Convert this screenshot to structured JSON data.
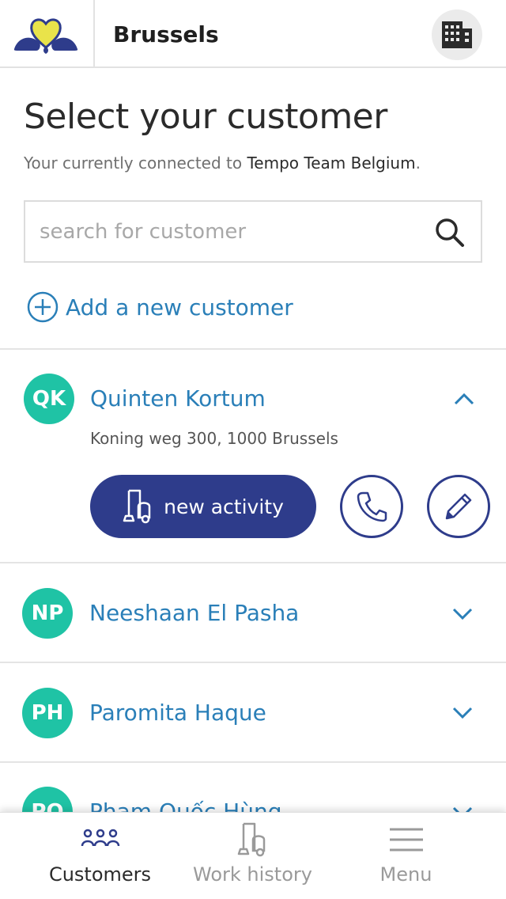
{
  "header": {
    "city": "Brussels",
    "brand_colors": {
      "heart": "#e9e34a",
      "leaves": "#2e3c8b"
    }
  },
  "intro": {
    "title": "Select your customer",
    "subtitle_prefix": "Your currently connected to ",
    "organization": "Tempo Team Belgium",
    "subtitle_suffix": "."
  },
  "search": {
    "placeholder": "search for customer",
    "value": ""
  },
  "add_customer": {
    "label": "Add a new customer"
  },
  "customers": [
    {
      "initials": "QK",
      "name": "Quinten Kortum",
      "address": "Koning weg 300, 1000 Brussels",
      "expanded": true,
      "new_activity_label": "new activity"
    },
    {
      "initials": "NP",
      "name": "Neeshaan El Pasha",
      "expanded": false
    },
    {
      "initials": "PH",
      "name": "Paromita Haque",
      "expanded": false
    },
    {
      "initials": "PQ",
      "name": "Pham Quốc Hùng",
      "expanded": false
    }
  ],
  "bottom_nav": [
    {
      "label": "Customers",
      "icon": "people-icon",
      "active": true
    },
    {
      "label": "Work history",
      "icon": "vacuum-icon",
      "active": false
    },
    {
      "label": "Menu",
      "icon": "hamburger-icon",
      "active": false
    }
  ],
  "colors": {
    "accent_blue": "#2a7fb8",
    "primary_navy": "#2e3c8b",
    "avatar_teal": "#1fc3a5"
  }
}
